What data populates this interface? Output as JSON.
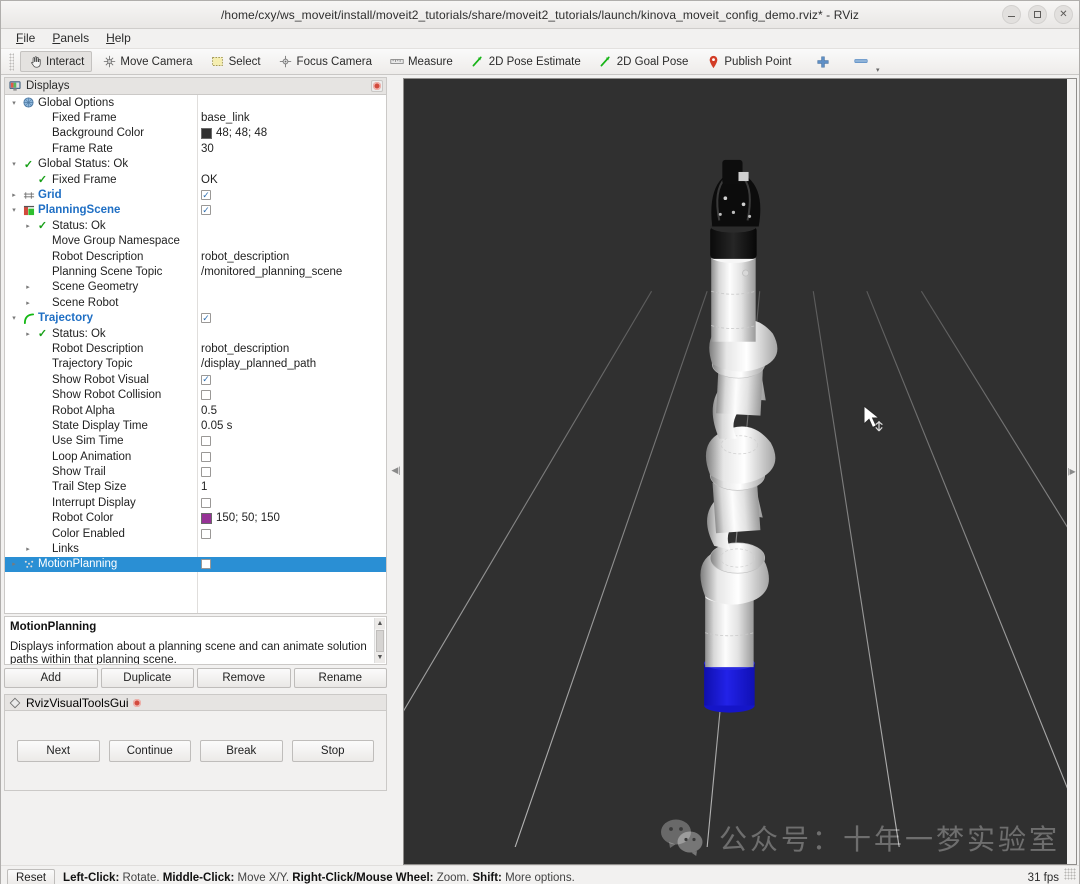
{
  "window": {
    "title": "/home/cxy/ws_moveit/install/moveit2_tutorials/share/moveit2_tutorials/launch/kinova_moveit_config_demo.rviz* - RViz",
    "minimize_label": "",
    "maximize_label": "",
    "close_label": "✕"
  },
  "menubar": [
    {
      "label": "File"
    },
    {
      "label": "Panels"
    },
    {
      "label": "Help"
    }
  ],
  "toolbar": [
    {
      "label": "Interact",
      "icon": "hand-icon",
      "active": true
    },
    {
      "label": "Move Camera",
      "icon": "move-camera-icon",
      "active": false
    },
    {
      "label": "Select",
      "icon": "select-icon",
      "active": false
    },
    {
      "label": "Focus Camera",
      "icon": "focus-camera-icon",
      "active": false
    },
    {
      "label": "Measure",
      "icon": "measure-icon",
      "active": false
    },
    {
      "label": "2D Pose Estimate",
      "icon": "pose-arrow-icon",
      "active": false
    },
    {
      "label": "2D Goal Pose",
      "icon": "goal-arrow-icon",
      "active": false
    },
    {
      "label": "Publish Point",
      "icon": "map-pin-icon",
      "active": false
    },
    {
      "label": "",
      "icon": "plus-icon",
      "active": false
    },
    {
      "label": "",
      "icon": "minus-toolbar-icon",
      "active": false
    }
  ],
  "displays_panel": {
    "title": "Displays",
    "close_icon": "close-panel-icon",
    "rows": [
      {
        "indent": 0,
        "arrow": "open",
        "icon": "global-options-icon",
        "name": "Global Options",
        "value": "",
        "vtype": "text",
        "bold": false
      },
      {
        "indent": 1,
        "arrow": "none",
        "icon": "",
        "name": "Fixed Frame",
        "value": "base_link",
        "vtype": "text",
        "bold": false
      },
      {
        "indent": 1,
        "arrow": "none",
        "icon": "",
        "name": "Background Color",
        "value": "48; 48; 48",
        "vtype": "color",
        "color": "#303030",
        "bold": false
      },
      {
        "indent": 1,
        "arrow": "none",
        "icon": "",
        "name": "Frame Rate",
        "value": "30",
        "vtype": "text",
        "bold": false
      },
      {
        "indent": 0,
        "arrow": "open",
        "icon": "check-icon",
        "name": "Global Status: Ok",
        "value": "",
        "vtype": "text",
        "bold": false
      },
      {
        "indent": 1,
        "arrow": "none",
        "icon": "check-icon",
        "name": "Fixed Frame",
        "value": "OK",
        "vtype": "text",
        "bold": false
      },
      {
        "indent": 0,
        "arrow": "closed",
        "icon": "grid-icon",
        "name": "Grid",
        "value": "",
        "vtype": "checkbox",
        "checked": true,
        "bold": true
      },
      {
        "indent": 0,
        "arrow": "open",
        "icon": "planning-scene-icon",
        "name": "PlanningScene",
        "value": "",
        "vtype": "checkbox",
        "checked": true,
        "bold": true
      },
      {
        "indent": 1,
        "arrow": "closed",
        "icon": "check-icon",
        "name": "Status: Ok",
        "value": "",
        "vtype": "text",
        "bold": false
      },
      {
        "indent": 1,
        "arrow": "none",
        "icon": "",
        "name": "Move Group Namespace",
        "value": "",
        "vtype": "text",
        "bold": false
      },
      {
        "indent": 1,
        "arrow": "none",
        "icon": "",
        "name": "Robot Description",
        "value": "robot_description",
        "vtype": "text",
        "bold": false
      },
      {
        "indent": 1,
        "arrow": "none",
        "icon": "",
        "name": "Planning Scene Topic",
        "value": "/monitored_planning_scene",
        "vtype": "text",
        "bold": false
      },
      {
        "indent": 1,
        "arrow": "closed",
        "icon": "",
        "name": "Scene Geometry",
        "value": "",
        "vtype": "text",
        "bold": false
      },
      {
        "indent": 1,
        "arrow": "closed",
        "icon": "",
        "name": "Scene Robot",
        "value": "",
        "vtype": "text",
        "bold": false
      },
      {
        "indent": 0,
        "arrow": "open",
        "icon": "trajectory-icon",
        "name": "Trajectory",
        "value": "",
        "vtype": "checkbox",
        "checked": true,
        "bold": true
      },
      {
        "indent": 1,
        "arrow": "closed",
        "icon": "check-icon",
        "name": "Status: Ok",
        "value": "",
        "vtype": "text",
        "bold": false
      },
      {
        "indent": 1,
        "arrow": "none",
        "icon": "",
        "name": "Robot Description",
        "value": "robot_description",
        "vtype": "text",
        "bold": false
      },
      {
        "indent": 1,
        "arrow": "none",
        "icon": "",
        "name": "Trajectory Topic",
        "value": "/display_planned_path",
        "vtype": "text",
        "bold": false
      },
      {
        "indent": 1,
        "arrow": "none",
        "icon": "",
        "name": "Show Robot Visual",
        "value": "",
        "vtype": "checkbox",
        "checked": true,
        "bold": false
      },
      {
        "indent": 1,
        "arrow": "none",
        "icon": "",
        "name": "Show Robot Collision",
        "value": "",
        "vtype": "checkbox",
        "checked": false,
        "bold": false
      },
      {
        "indent": 1,
        "arrow": "none",
        "icon": "",
        "name": "Robot Alpha",
        "value": "0.5",
        "vtype": "text",
        "bold": false
      },
      {
        "indent": 1,
        "arrow": "none",
        "icon": "",
        "name": "State Display Time",
        "value": "0.05 s",
        "vtype": "text",
        "bold": false
      },
      {
        "indent": 1,
        "arrow": "none",
        "icon": "",
        "name": "Use Sim Time",
        "value": "",
        "vtype": "checkbox",
        "checked": false,
        "bold": false
      },
      {
        "indent": 1,
        "arrow": "none",
        "icon": "",
        "name": "Loop Animation",
        "value": "",
        "vtype": "checkbox",
        "checked": false,
        "bold": false
      },
      {
        "indent": 1,
        "arrow": "none",
        "icon": "",
        "name": "Show Trail",
        "value": "",
        "vtype": "checkbox",
        "checked": false,
        "bold": false
      },
      {
        "indent": 1,
        "arrow": "none",
        "icon": "",
        "name": "Trail Step Size",
        "value": "1",
        "vtype": "text",
        "bold": false
      },
      {
        "indent": 1,
        "arrow": "none",
        "icon": "",
        "name": "Interrupt Display",
        "value": "",
        "vtype": "checkbox",
        "checked": false,
        "bold": false
      },
      {
        "indent": 1,
        "arrow": "none",
        "icon": "",
        "name": "Robot Color",
        "value": "150; 50; 150",
        "vtype": "color",
        "color": "#963296",
        "bold": false
      },
      {
        "indent": 1,
        "arrow": "none",
        "icon": "",
        "name": "Color Enabled",
        "value": "",
        "vtype": "checkbox",
        "checked": false,
        "bold": false
      },
      {
        "indent": 1,
        "arrow": "closed",
        "icon": "",
        "name": "Links",
        "value": "",
        "vtype": "text",
        "bold": false
      },
      {
        "indent": 0,
        "arrow": "closed",
        "icon": "motion-planning-icon",
        "name": "MotionPlanning",
        "value": "",
        "vtype": "checkbox",
        "checked": false,
        "bold": false,
        "selected": true
      }
    ]
  },
  "description": {
    "title": "MotionPlanning",
    "text": "Displays information about a planning scene and can animate solution paths within that planning scene."
  },
  "display_buttons": [
    {
      "label": "Add"
    },
    {
      "label": "Duplicate"
    },
    {
      "label": "Remove"
    },
    {
      "label": "Rename"
    }
  ],
  "visual_tools_panel": {
    "title": "RvizVisualToolsGui",
    "close_icon": "close-panel-icon",
    "buttons": [
      {
        "label": "Next"
      },
      {
        "label": "Continue"
      },
      {
        "label": "Break"
      },
      {
        "label": "Stop"
      }
    ]
  },
  "viewport": {
    "background_color": "#303030",
    "grid_color": "#9a9a9a",
    "robot_color": "#e8e8e8",
    "base_color": "#1a1ad0",
    "gripper_color": "#111111",
    "watermark_text": "公众号：十年一梦实验室",
    "watermark_icon": "wechat-icon"
  },
  "statusbar": {
    "reset_label": "Reset",
    "hint_parts": [
      {
        "bold": "Left-Click:",
        "normal": " Rotate."
      },
      {
        "bold": "Middle-Click:",
        "normal": " Move X/Y."
      },
      {
        "bold": "Right-Click/Mouse Wheel:",
        "normal": " Zoom."
      },
      {
        "bold": "Shift:",
        "normal": " More options."
      }
    ],
    "fps": "31 fps"
  }
}
